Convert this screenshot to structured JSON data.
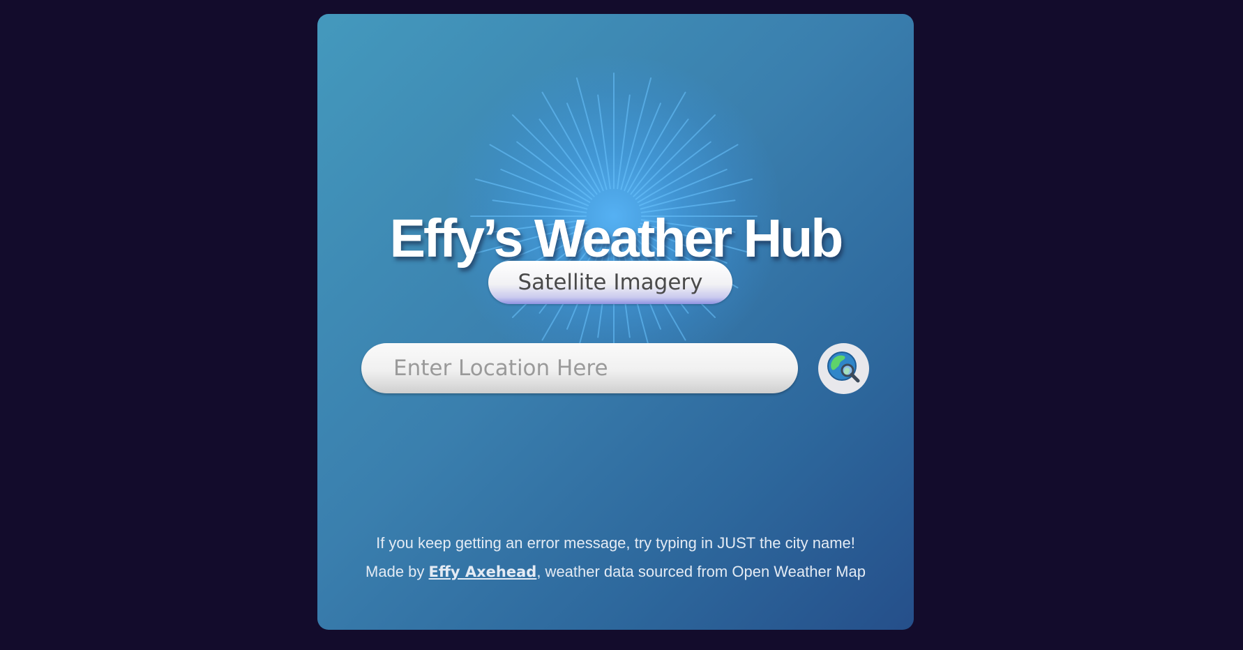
{
  "app": {
    "title": "Effy’s Weather Hub"
  },
  "satellite_button": {
    "label": "Satellite Imagery"
  },
  "search": {
    "value": "",
    "placeholder": "Enter Location Here",
    "button_icon": "globe-search-icon"
  },
  "footer": {
    "hint": "If you keep getting an error message, try typing in JUST the city name!",
    "made_by_prefix": "Made by ",
    "author": "Effy Axehead",
    "made_by_suffix": ", weather data sourced from Open Weather Map"
  },
  "colors": {
    "page_background": "#130c2c",
    "card_gradient_start": "#4499bd",
    "card_gradient_end": "#254f8a",
    "burst": "#5ab9ff",
    "text": "#ffffff"
  }
}
